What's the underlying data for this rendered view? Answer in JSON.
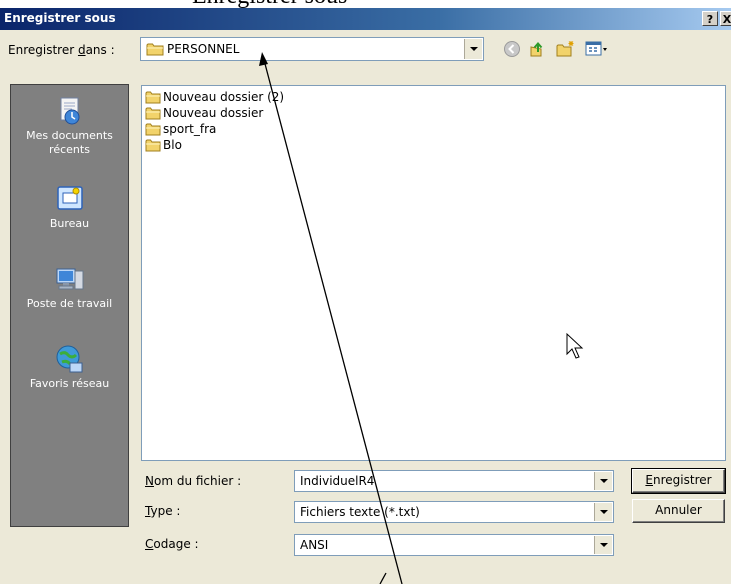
{
  "caption_fragment": "Enregistrer sous",
  "window": {
    "title": "Enregistrer sous",
    "help_label": "?",
    "close_label": "X"
  },
  "save_in": {
    "label_prefix": "Enregistrer ",
    "label_access": "d",
    "label_suffix": "ans :",
    "value": "PERSONNEL"
  },
  "toolbar": {
    "icons": [
      "back-icon",
      "up-folder-icon",
      "new-folder-icon",
      "view-menu-icon"
    ]
  },
  "places": [
    {
      "label": "Mes documents récents",
      "icon": "recent-documents-icon"
    },
    {
      "label": "Bureau",
      "icon": "desktop-icon"
    },
    {
      "label": "Poste de travail",
      "icon": "my-computer-icon"
    },
    {
      "label": "Favoris réseau",
      "icon": "network-places-icon"
    }
  ],
  "files": [
    {
      "name": "Nouveau dossier (2)",
      "icon": "folder-icon"
    },
    {
      "name": "Nouveau dossier",
      "icon": "folder-icon"
    },
    {
      "name": "sport_fra",
      "icon": "folder-icon"
    },
    {
      "name": "Blo",
      "icon": "folder-icon"
    }
  ],
  "fields": {
    "filename": {
      "label_access": "N",
      "label_rest": "om du fichier :",
      "value": "IndividuelR4"
    },
    "type": {
      "label_access": "T",
      "label_rest": "ype :",
      "value": "Fichiers texte (*.txt)"
    },
    "encoding": {
      "label_access": "C",
      "label_rest": "odage :",
      "value": "ANSI"
    }
  },
  "buttons": {
    "save_access": "E",
    "save_rest": "nregistrer",
    "cancel": "Annuler"
  },
  "colors": {
    "title_bar": "#0a246a",
    "dialog_bg": "#ece9d8",
    "places_bg": "#808080",
    "folder_yellow": "#f2d36b"
  }
}
